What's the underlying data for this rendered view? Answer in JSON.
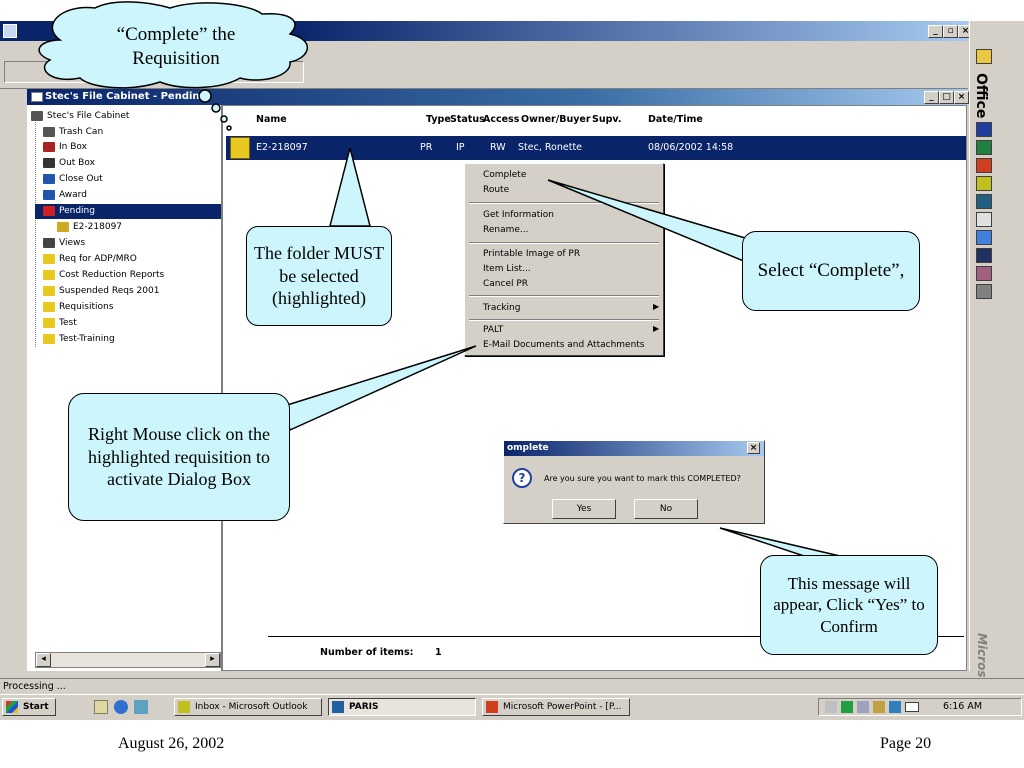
{
  "file_cabinet": {
    "title": "Stec's File Cabinet - Pending"
  },
  "tree": [
    {
      "label": "Stec's File Cabinet",
      "icon": "cabinet-icon",
      "color": "#555555"
    },
    {
      "label": "Trash Can",
      "icon": "trash-icon",
      "color": "#555555"
    },
    {
      "label": "In Box",
      "icon": "inbox-icon",
      "color": "#aa2222"
    },
    {
      "label": "Out Box",
      "icon": "outbox-icon",
      "color": "#333333"
    },
    {
      "label": "Close Out",
      "icon": "closeout-icon",
      "color": "#2255aa"
    },
    {
      "label": "Award",
      "icon": "award-icon",
      "color": "#2255aa"
    },
    {
      "label": "Pending",
      "icon": "pending-icon",
      "color": "#cc2222"
    },
    {
      "label": "E2-218097",
      "icon": "document-icon",
      "color": "#ccaa22"
    },
    {
      "label": "Views",
      "icon": "views-icon",
      "color": "#444444"
    },
    {
      "label": "Req for ADP/MRO",
      "icon": "folder-icon",
      "color": "#e8c820"
    },
    {
      "label": "Cost Reduction Reports",
      "icon": "folder-icon",
      "color": "#e8c820"
    },
    {
      "label": "Suspended Reqs 2001",
      "icon": "folder-icon",
      "color": "#e8c820"
    },
    {
      "label": "Requisitions",
      "icon": "folder-icon",
      "color": "#e8c820"
    },
    {
      "label": "Test",
      "icon": "folder-icon",
      "color": "#e8c820"
    },
    {
      "label": "Test-Training",
      "icon": "folder-icon",
      "color": "#e8c820"
    }
  ],
  "list": {
    "columns": {
      "name": "Name",
      "type": "Type",
      "status": "Status",
      "access": "Access",
      "owner": "Owner/Buyer",
      "supv": "Supv.",
      "datetime": "Date/Time"
    },
    "row": {
      "name": "E2-218097",
      "type": "PR",
      "status": "IP",
      "access": "RW",
      "owner": "Stec, Ronette",
      "datetime": "08/06/2002 14:58"
    },
    "count_label": "Number of items:",
    "count": "1"
  },
  "context_menu": {
    "complete": "Complete",
    "route": "Route",
    "get_info": "Get Information",
    "rename": "Rename...",
    "printable": "Printable Image of PR",
    "item_list": "Item List...",
    "cancel_pr": "Cancel PR",
    "tracking": "Tracking",
    "palt": "PALT",
    "email": "E-Mail Documents and Attachments"
  },
  "dialog": {
    "title": "omplete",
    "message": "Are you sure you want to mark this COMPLETED?",
    "yes": "Yes",
    "no": "No"
  },
  "status_bar": {
    "text": "Processing ..."
  },
  "taskbar": {
    "start": "Start",
    "tasks": [
      "Inbox - Microsoft Outlook",
      "PARIS",
      "Microsoft PowerPoint - [P..."
    ],
    "clock": "6:16 AM"
  },
  "office_bar": {
    "label": "Office",
    "brand": "Microsoft"
  },
  "callouts": {
    "complete_title": "“Complete”  the Requisition",
    "folder_selected": "The folder MUST be selected (highlighted)",
    "select_complete": "Select “Complete”,",
    "right_click": "Right Mouse click on the highlighted requisition  to activate Dialog Box",
    "confirm": "This message will appear, Click “Yes” to Confirm"
  },
  "footer": {
    "date": "August 26, 2002",
    "page": "Page 20"
  }
}
